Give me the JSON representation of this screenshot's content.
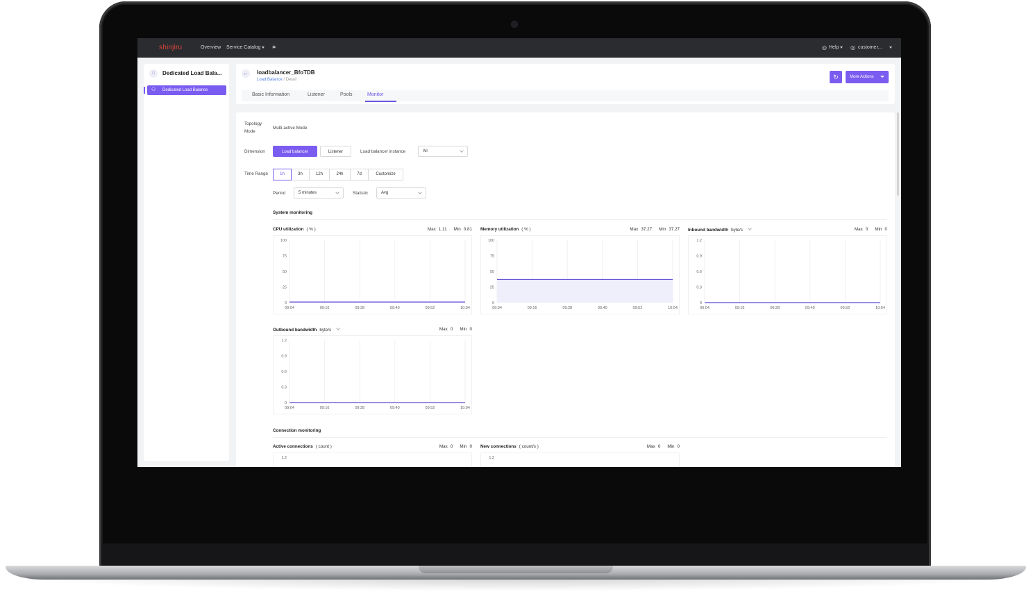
{
  "topbar": {
    "logo": "shinjiru",
    "nav": [
      "Overview",
      "Service Catalog"
    ],
    "help": "Help",
    "user": "customer..."
  },
  "sidebar": {
    "title": "Dedicated Load Bala...",
    "items": [
      {
        "label": "Dedicated Load Balance"
      }
    ]
  },
  "header": {
    "name": "loadbalancer_BfoTDB",
    "breadcrumb_link": "Load Balance",
    "breadcrumb_rest": "/ Detail",
    "more_actions": "More Actions",
    "tabs": [
      "Basic Information",
      "Listener",
      "Pools",
      "Monitor"
    ],
    "active_tab": "Monitor"
  },
  "filters": {
    "topology_label_1": "Topology",
    "topology_label_2": "Mode",
    "topology_value": "Multi-active Mode",
    "dimension_label": "Dimension",
    "dimension_options": [
      "Load balancer",
      "Listener"
    ],
    "instance_label": "Load balancer instance",
    "instance_value": "All",
    "time_range_label": "Time Range",
    "time_ranges": [
      "1h",
      "3h",
      "12h",
      "24h",
      "7d",
      "Customize"
    ],
    "period_label": "Period",
    "period_value": "5 minutes",
    "statistic_label": "Statistic",
    "statistic_value": "Avg"
  },
  "sections": {
    "system": "System monitoring",
    "connection": "Connection monitoring"
  },
  "colors": {
    "accent": "#7b5cf0",
    "line": "#5b4bd6",
    "fill": "#efeefb"
  },
  "chart_data": [
    {
      "type": "area",
      "title": "CPU utilization",
      "unit": "( % )",
      "max_label": "Max",
      "max": "1.11",
      "min_label": "Min",
      "min": "0.81",
      "x": [
        "09:04",
        "09:16",
        "09:28",
        "09:40",
        "09:52",
        "10:04"
      ],
      "yticks": [
        "100",
        "75",
        "50",
        "25",
        "0"
      ],
      "ylim": [
        0,
        100
      ],
      "series": [
        {
          "values": [
            1.0,
            1.0,
            1.0,
            1.0,
            1.0,
            1.0
          ]
        }
      ]
    },
    {
      "type": "area",
      "title": "Memory utilization",
      "unit": "( % )",
      "max_label": "Max",
      "max": "37.27",
      "min_label": "Min",
      "min": "37.27",
      "x": [
        "09:04",
        "09:16",
        "09:28",
        "09:40",
        "09:52",
        "10:04"
      ],
      "yticks": [
        "100",
        "75",
        "50",
        "25",
        "0"
      ],
      "ylim": [
        0,
        100
      ],
      "series": [
        {
          "values": [
            37.27,
            37.27,
            37.27,
            37.27,
            37.27,
            37.27
          ]
        }
      ]
    },
    {
      "type": "area",
      "title": "Inbound bandwidth",
      "unit": "byte/s",
      "unit_dropdown": true,
      "max_label": "Max",
      "max": "0",
      "min_label": "Min",
      "min": "0",
      "x": [
        "09:04",
        "09:16",
        "09:28",
        "09:40",
        "09:52",
        "10:04"
      ],
      "yticks": [
        "1.2",
        "0.9",
        "0.6",
        "0.3",
        "0"
      ],
      "ylim": [
        0,
        1.2
      ],
      "series": [
        {
          "values": [
            0,
            0,
            0,
            0,
            0,
            0
          ]
        }
      ]
    },
    {
      "type": "area",
      "title": "Outbound bandwidth",
      "unit": "byte/s",
      "unit_dropdown": true,
      "max_label": "Max",
      "max": "0",
      "min_label": "Min",
      "min": "0",
      "x": [
        "09:04",
        "09:16",
        "09:28",
        "09:40",
        "09:52",
        "10:04"
      ],
      "yticks": [
        "1.2",
        "0.9",
        "0.6",
        "0.3",
        "0"
      ],
      "ylim": [
        0,
        1.2
      ],
      "series": [
        {
          "values": [
            0,
            0,
            0,
            0,
            0,
            0
          ]
        }
      ]
    },
    {
      "type": "area",
      "title": "Active connections",
      "unit": "( count )",
      "max_label": "Max",
      "max": "0",
      "min_label": "Min",
      "min": "0",
      "x": [],
      "yticks": [
        "1.2"
      ],
      "ylim": [
        0,
        1.2
      ],
      "series": [
        {
          "values": []
        }
      ]
    },
    {
      "type": "area",
      "title": "New connections",
      "unit": "( count/s )",
      "max_label": "Max",
      "max": "0",
      "min_label": "Min",
      "min": "0",
      "x": [],
      "yticks": [
        "1.2"
      ],
      "ylim": [
        0,
        1.2
      ],
      "series": [
        {
          "values": []
        }
      ]
    }
  ]
}
